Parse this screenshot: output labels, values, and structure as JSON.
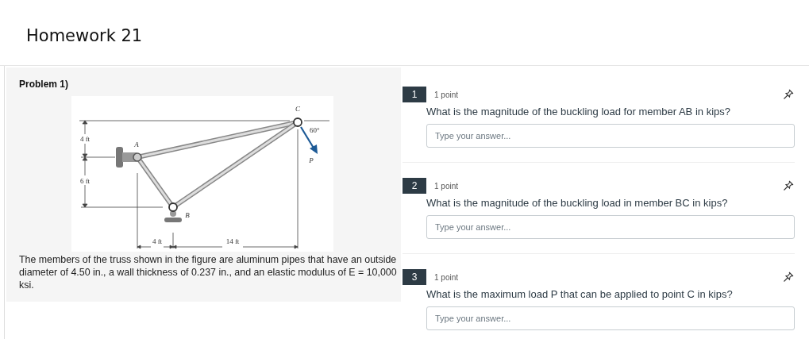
{
  "title": "Homework 21",
  "problem": {
    "heading": "Problem 1)",
    "figure_labels": {
      "c": "C",
      "a": "A",
      "b": "B",
      "p": "P",
      "angle": "60°",
      "dim_upper_vertical": "4 ft",
      "dim_lower_vertical": "6 ft",
      "dim_left_horizontal": "4 ft",
      "dim_right_horizontal": "14 ft"
    },
    "description": "The members of the truss shown in the figure are aluminum pipes that have an outside diameter of 4.50 in., a wall thickness of 0.237 in., and an elastic modulus of E = 10,000 ksi."
  },
  "questions": [
    {
      "number": "1",
      "points": "1 point",
      "text": "What is the magnitude of the buckling load for member AB in kips?",
      "placeholder": "Type your answer..."
    },
    {
      "number": "2",
      "points": "1 point",
      "text": "What is the magnitude of the buckling load in member BC in kips?",
      "placeholder": "Type your answer..."
    },
    {
      "number": "3",
      "points": "1 point",
      "text": "What is the maximum load P that can be applied to point C in kips?",
      "placeholder": "Type your answer..."
    }
  ]
}
